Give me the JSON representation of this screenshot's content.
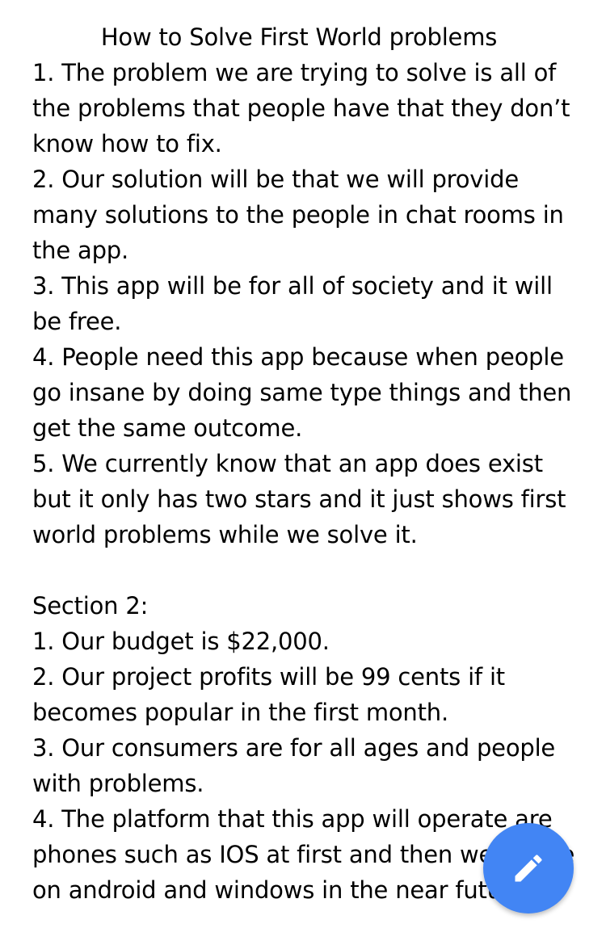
{
  "document": {
    "title": "How to Solve First World problems",
    "section1": [
      "1. The problem we are trying to solve is all of the problems that people have that they don’t know how to fix.",
      "2. Our solution will be that we will provide many solutions to the people in chat rooms in the app.",
      "3. This app will be for all of society and it will be free.",
      "4. People need this app because when people go insane by doing same type things and then get the same outcome.",
      "5. We currently know that an app does exist but it only has two stars and it just shows first world problems while we solve it."
    ],
    "section2_heading": "Section 2:",
    "section2": [
      "1. Our budget is $22,000.",
      "2. Our project profits will be 99 cents if it becomes popular in the first month.",
      "3. Our consumers are for all ages and people with problems.",
      "4. The platform that this app will operate are phones such as IOS at first and then we will be on android and windows in the near future."
    ]
  },
  "fab": {
    "icon": "edit-pencil-icon",
    "color": "#4285f4"
  }
}
